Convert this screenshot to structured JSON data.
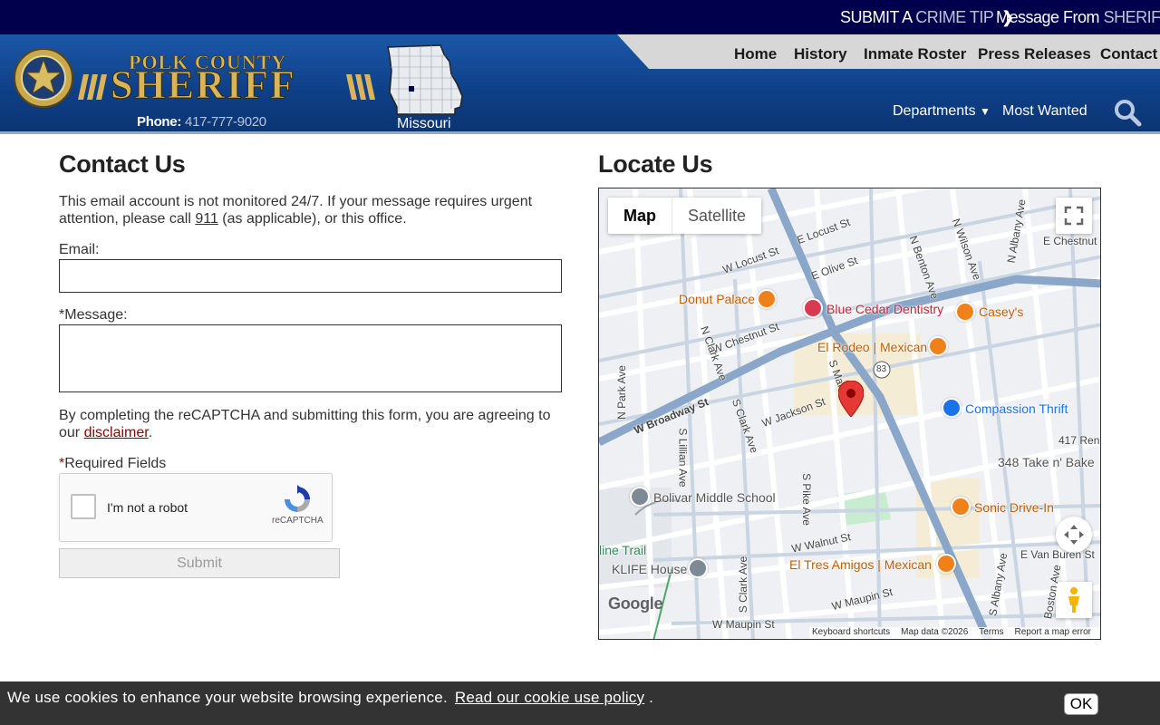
{
  "topbar": {
    "crime_tip": {
      "lead": "SUBMIT A",
      "accent": "CRIME TIP"
    },
    "message": {
      "lead": "Message From",
      "accent": "SHERIFF"
    }
  },
  "header": {
    "wordmark_top": "POLK COUNTY",
    "wordmark": "SHERIFF",
    "phone_label": "Phone:",
    "phone_number": "417-777-9020",
    "state_label": "Missouri",
    "nav": [
      "Home",
      "History",
      "Inmate Roster",
      "Press Releases",
      "Contact"
    ],
    "subnav": {
      "departments": "Departments",
      "most_wanted": "Most Wanted"
    }
  },
  "contact": {
    "title": "Contact Us",
    "notice_1": "This email account is not monitored 24/7. If your message requires urgent",
    "notice_2a": "attention, please call ",
    "notice_phone": "911",
    "notice_2b": " (as applicable), or this office.",
    "email_label": "Email:",
    "email_value": "",
    "message_label": "Message:",
    "message_value": "",
    "agree_1": "By completing the reCAPTCHA and submitting this form, you are agreeing to",
    "agree_2a": "our ",
    "disclaimer_link": "disclaimer",
    "agree_2b": ".",
    "required_note": "Required Fields",
    "asterisk": "*",
    "captcha_label": "I'm not a robot",
    "captcha_brand": "reCAPTCHA",
    "submit_label": "Submit"
  },
  "locate": {
    "title": "Locate Us",
    "map_tabs": [
      "Map",
      "Satellite"
    ],
    "streets": [
      "W Locust St",
      "E Locust St",
      "E Olive St",
      "N Benton Ave",
      "N Wilson Ave",
      "N Albany Ave",
      "E Chestnut",
      "W Chestnut St",
      "N Clark Ave",
      "N Park Ave",
      "W Broadway St",
      "S Clark Ave",
      "S Lillian Ave",
      "W Jackson St",
      "S Main",
      "S Pike Ave",
      "W Walnut St",
      "E Van Buren St",
      "W Maupin St",
      "W Maupin St",
      "S Clark Ave",
      "S Albany Ave",
      "Boston Ave",
      "417 Ren",
      "83"
    ],
    "places": [
      {
        "name": "Donut Palace",
        "kind": "food"
      },
      {
        "name": "Blue Cedar Dentistry",
        "kind": "med"
      },
      {
        "name": "Casey's",
        "kind": "food"
      },
      {
        "name": "El Rodeo | Mexican",
        "kind": "food"
      },
      {
        "name": "Compassion Thrift",
        "kind": "shop"
      },
      {
        "name": "348 Take n' Bake",
        "kind": "plain"
      },
      {
        "name": "Bolivar Middle School",
        "kind": "school"
      },
      {
        "name": "Sonic Drive-In",
        "kind": "food"
      },
      {
        "name": "line Trail",
        "kind": "trail"
      },
      {
        "name": "KLIFE House",
        "kind": "plain"
      },
      {
        "name": "El Tres Amigos | Mexican",
        "kind": "food"
      }
    ],
    "google": "Google",
    "attribution": [
      "Keyboard shortcuts",
      "Map data ©2026",
      "Terms",
      "Report a map error"
    ]
  },
  "cookie": {
    "text": "We use cookies to enhance your website browsing experience.",
    "link": "Read our cookie use policy",
    "suffix": " .",
    "ok": "OK"
  },
  "colors": {
    "topbar": "#00004d",
    "header_blue": "#1b58a9",
    "accent_gold": "#d9b45a",
    "link_red": "#8c0000",
    "cookie_bg": "#333333"
  }
}
